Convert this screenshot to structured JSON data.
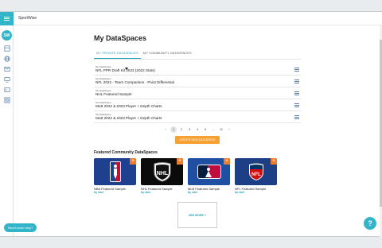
{
  "app": {
    "name": "SportWise"
  },
  "rail": {
    "avatar_initials": "SW",
    "icons": [
      "dashboard-icon",
      "globe-icon",
      "message-icon",
      "tv-icon",
      "id-card-icon",
      "grid-icon"
    ]
  },
  "page": {
    "title": "My DataSpaces",
    "tabs": [
      {
        "label": "MY PRIVATE DATASPACES",
        "active": true
      },
      {
        "label": "MY COMMUNITY DATASPACES",
        "active": false
      }
    ],
    "dataspaces": [
      {
        "kicker": "My DataSpace",
        "title": "NFL PPR Draft Kit 2023 (2022 Stats)"
      },
      {
        "kicker": "My DataSpace",
        "title": "NFL 2022 - Team Comparison - Point Differential"
      },
      {
        "kicker": "My DataSpace",
        "title": "NHL Featured Sample"
      },
      {
        "kicker": "My DataSpace",
        "title": "MLB 2022 & 2023 Player + Depth Charts"
      },
      {
        "kicker": "My DataSpace",
        "title": "MLB 2022 & 2023 Player + Depth Charts"
      }
    ],
    "pager": {
      "prev": "‹",
      "pages": [
        "1",
        "2",
        "3",
        "4",
        "5",
        "...",
        "11"
      ],
      "current": "1",
      "next": "›"
    },
    "create_button": "CREATE NEW DATASPACE",
    "featured_title": "Featured Community DataSpaces",
    "featured": [
      {
        "name": "NBA Featured Sample",
        "by": "by sbcl",
        "logo": "NBA"
      },
      {
        "name": "NHL Featured Sample",
        "by": "by sbcl",
        "logo": "NHL"
      },
      {
        "name": "MLB Featured Sample",
        "by": "by sbcl",
        "logo": "MLB"
      },
      {
        "name": "NFL Featured Sample",
        "by": "by sbcl",
        "logo": "NFL"
      }
    ],
    "see_more": "SEE MORE +"
  },
  "help": {
    "pill": "Need some help?",
    "q": "?"
  },
  "colors": {
    "accent": "#33b5c9",
    "orange": "#f7a135",
    "plus": "#f07b2b"
  }
}
